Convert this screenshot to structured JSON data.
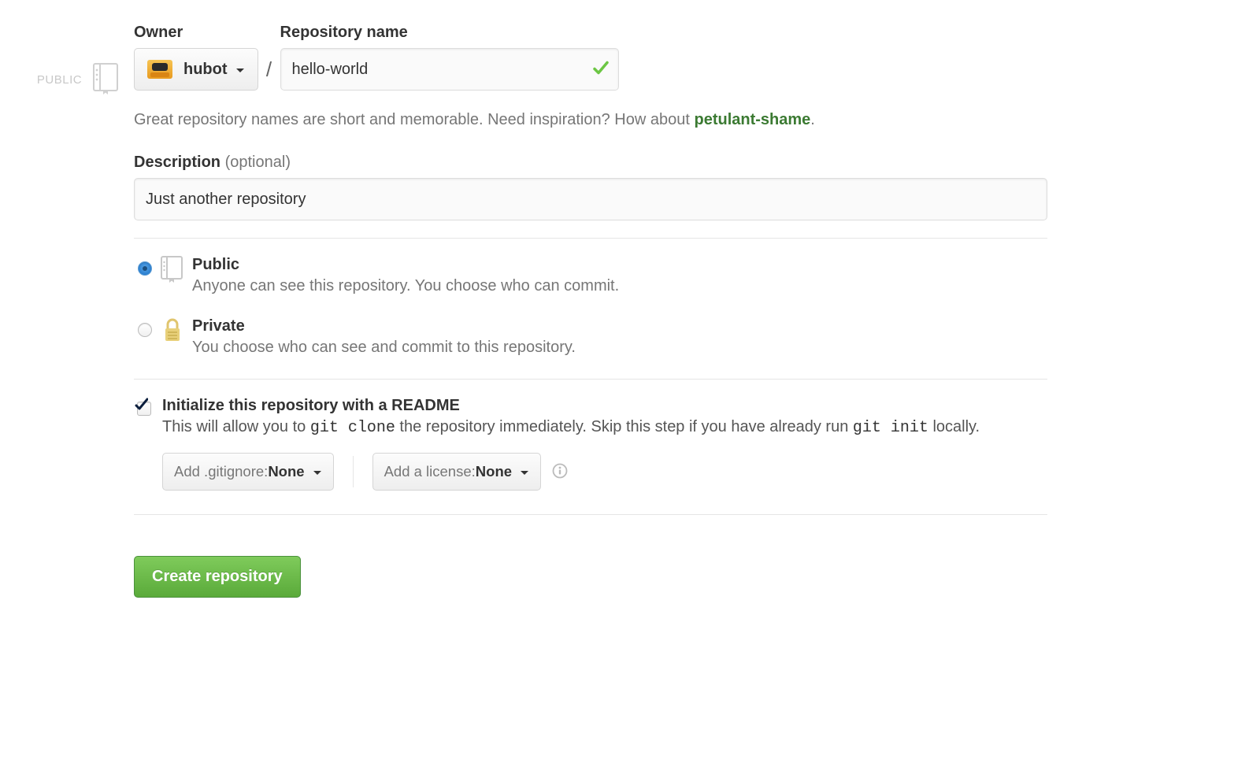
{
  "gutter": {
    "label": "PUBLIC"
  },
  "owner": {
    "label": "Owner",
    "selected": "hubot"
  },
  "repo_name": {
    "label": "Repository name",
    "value": "hello-world"
  },
  "name_help": {
    "prefix": "Great repository names are short and memorable. Need inspiration? How about ",
    "suggestion": "petulant-shame",
    "suffix": "."
  },
  "description": {
    "label": "Description",
    "optional": "(optional)",
    "value": "Just another repository"
  },
  "visibility": {
    "public": {
      "title": "Public",
      "desc": "Anyone can see this repository. You choose who can commit."
    },
    "private": {
      "title": "Private",
      "desc": "You choose who can see and commit to this repository."
    },
    "selected": "public"
  },
  "readme": {
    "checked": true,
    "title": "Initialize this repository with a README",
    "desc_before": "This will allow you to ",
    "code1": "git clone",
    "desc_mid": " the repository immediately. Skip this step if you have already run ",
    "code2": "git init",
    "desc_after": " locally."
  },
  "gitignore": {
    "label": "Add .gitignore: ",
    "value": "None"
  },
  "license": {
    "label": "Add a license: ",
    "value": "None"
  },
  "create_label": "Create repository"
}
